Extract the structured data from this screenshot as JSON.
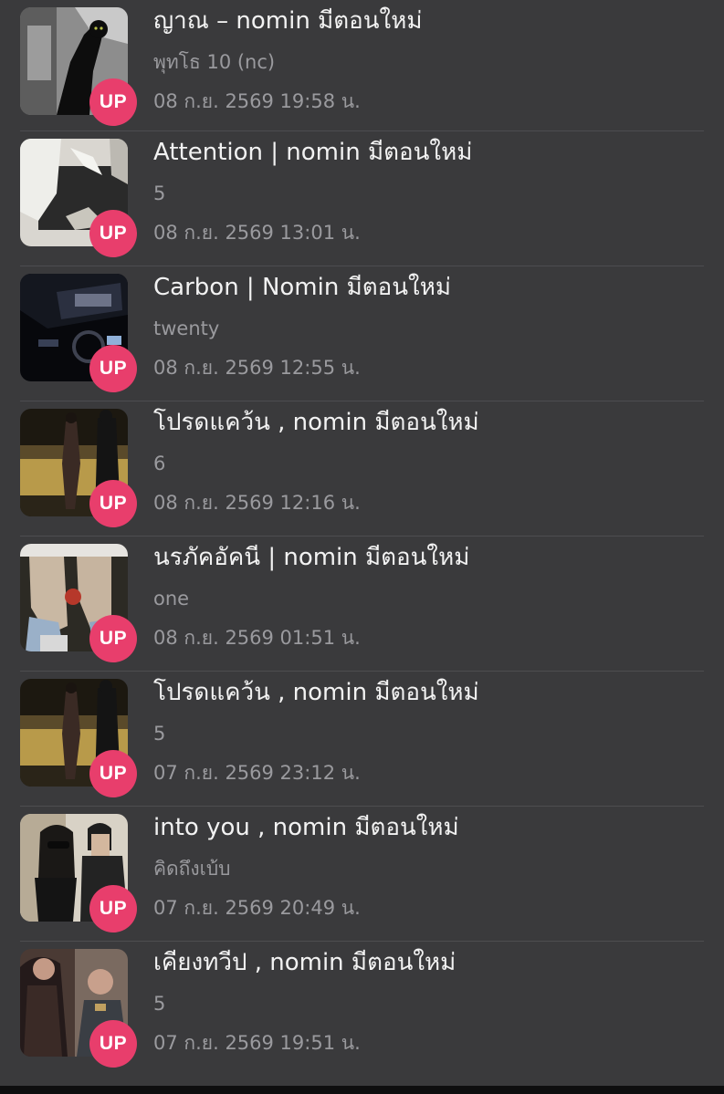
{
  "items": [
    {
      "title": "ญาณ – nomin มีตอนใหม่",
      "subtitle": "พุทโธ 10  (nc)",
      "date": "08 ก.ย. 2569 19:58 น.",
      "badge": "UP"
    },
    {
      "title": "Attention | nomin มีตอนใหม่",
      "subtitle": "5",
      "date": "08 ก.ย. 2569 13:01 น.",
      "badge": "UP"
    },
    {
      "title": "Carbon | Nomin มีตอนใหม่",
      "subtitle": "twenty",
      "date": "08 ก.ย. 2569 12:55 น.",
      "badge": "UP"
    },
    {
      "title": "โปรดแคว้น , nomin มีตอนใหม่",
      "subtitle": "6",
      "date": "08 ก.ย. 2569 12:16 น.",
      "badge": "UP"
    },
    {
      "title": "นรภัคอัคนี | nomin มีตอนใหม่",
      "subtitle": "one",
      "date": "08 ก.ย. 2569 01:51 น.",
      "badge": "UP"
    },
    {
      "title": "โปรดแคว้น , nomin มีตอนใหม่",
      "subtitle": "5",
      "date": "07 ก.ย. 2569 23:12 น.",
      "badge": "UP"
    },
    {
      "title": "into you , nomin มีตอนใหม่",
      "subtitle": "คิดถึงเบ้บ",
      "date": "07 ก.ย. 2569 20:49 น.",
      "badge": "UP"
    },
    {
      "title": "เคียงทวีป , nomin มีตอนใหม่",
      "subtitle": "5",
      "date": "07 ก.ย. 2569 19:51 น.",
      "badge": "UP"
    }
  ],
  "colors": {
    "background": "#3a3a3c",
    "badge": "#e83e6c",
    "title": "#f2f2f2",
    "secondary": "#9a9a9e"
  }
}
